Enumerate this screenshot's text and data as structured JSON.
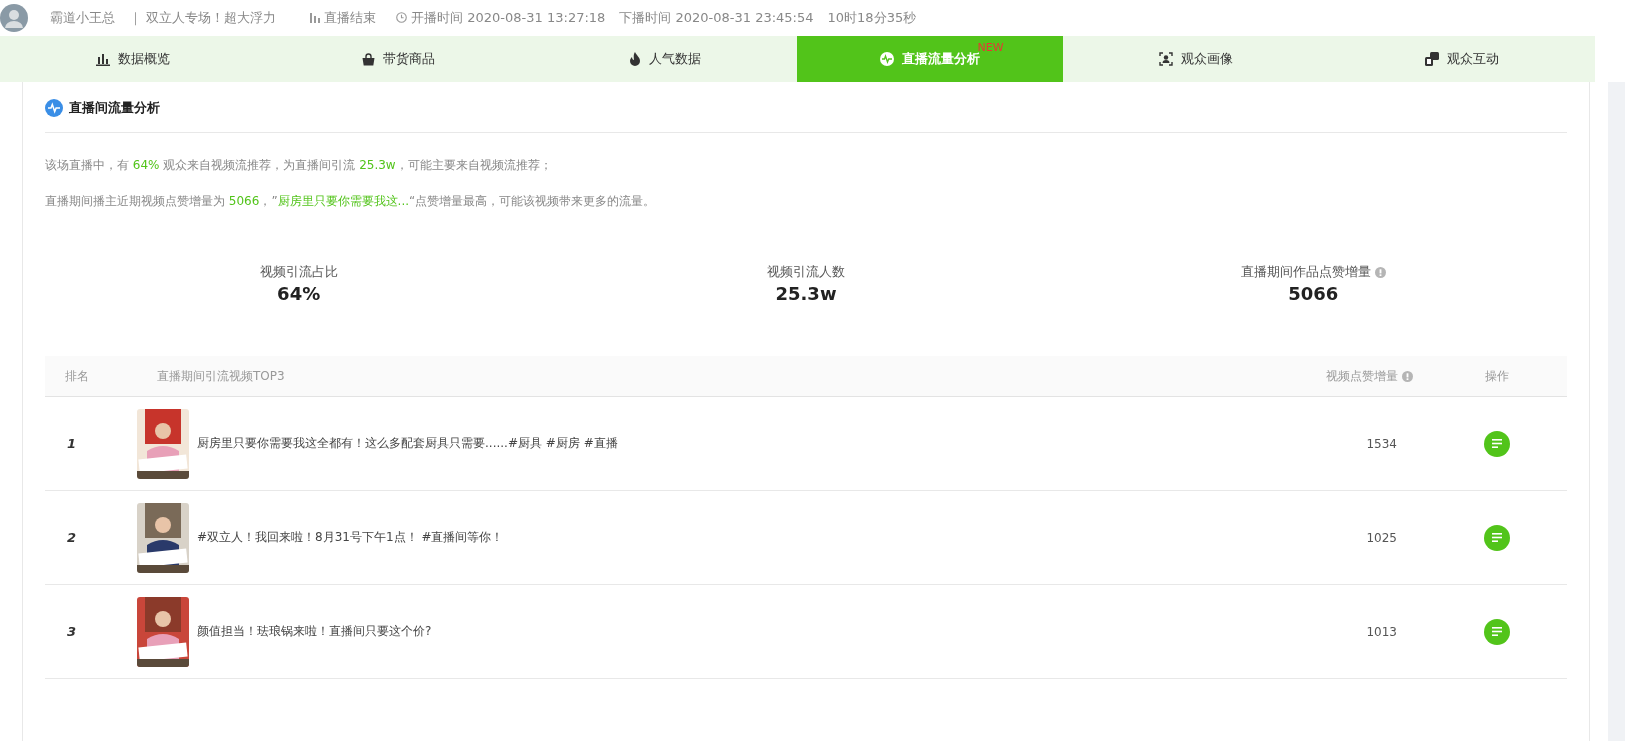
{
  "header": {
    "anchor": "霸道小王总",
    "room_title": "｜ 双立人专场！超大浮力",
    "status": "直播结束",
    "start_time": "开播时间 2020-08-31 13:27:18",
    "end_time": "下播时间 2020-08-31 23:45:54",
    "duration": "10时18分35秒"
  },
  "tabs": [
    {
      "label": "数据概览",
      "selected": false
    },
    {
      "label": "带货商品",
      "selected": false
    },
    {
      "label": "人气数据",
      "selected": false
    },
    {
      "label": "直播流量分析",
      "selected": true,
      "badge": "NEW"
    },
    {
      "label": "观众画像",
      "selected": false
    },
    {
      "label": "观众互动",
      "selected": false
    }
  ],
  "section": {
    "title": "直播间流量分析"
  },
  "summary": [
    [
      {
        "text": "该场直播中，有 ",
        "highlight": false
      },
      {
        "text": "64%",
        "highlight": true
      },
      {
        "text": " 观众来自视频流推荐，为直播间引流 ",
        "highlight": false
      },
      {
        "text": "25.3w",
        "highlight": true
      },
      {
        "text": "，可能主要来自视频流推荐；",
        "highlight": false
      }
    ],
    [
      {
        "text": "直播期间播主近期视频点赞增量为 ",
        "highlight": false
      },
      {
        "text": "5066",
        "highlight": true
      },
      {
        "text": "，”",
        "highlight": false
      },
      {
        "text": "厨房里只要你需要我这...",
        "highlight": true
      },
      {
        "text": "“点赞增量最高，可能该视频带来更多的流量。",
        "highlight": false
      }
    ]
  ],
  "stats": [
    {
      "label": "视频引流占比",
      "value": "64%",
      "info": false
    },
    {
      "label": "视频引流人数",
      "value": "25.3w",
      "info": false
    },
    {
      "label": "直播期间作品点赞增量",
      "value": "5066",
      "info": true
    }
  ],
  "table": {
    "columns": [
      {
        "label": "排名",
        "info": false
      },
      {
        "label": "直播期间引流视频TOP3",
        "info": false
      },
      {
        "label": "视频点赞增量",
        "info": true
      },
      {
        "label": "操作",
        "info": false
      }
    ],
    "rows": [
      {
        "rank": "1",
        "title": "厨房里只要你需要我这全都有！这么多配套厨具只需要......#厨具 #厨房 #直播",
        "likes": "1534"
      },
      {
        "rank": "2",
        "title": "#双立人！我回来啦！8月31号下午1点！ #直播间等你！",
        "likes": "1025"
      },
      {
        "rank": "3",
        "title": "颜值担当！珐琅锅来啦！直播间只要这个价?",
        "likes": "1013"
      }
    ]
  }
}
